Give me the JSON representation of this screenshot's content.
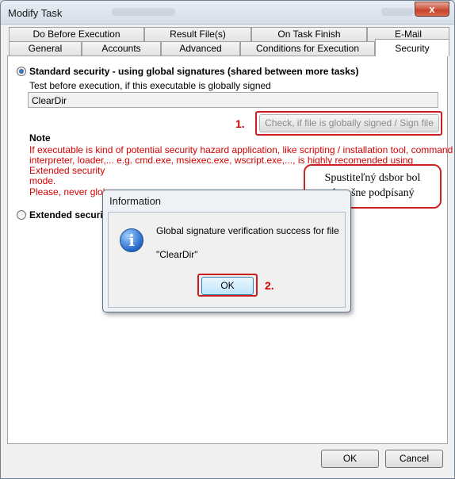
{
  "window": {
    "title": "Modify Task",
    "close_glyph": "x"
  },
  "tabs_top": [
    "Do Before Execution",
    "Result File(s)",
    "On Task Finish",
    "E-Mail"
  ],
  "tabs_bottom": [
    "General",
    "Accounts",
    "Advanced",
    "Conditions for Execution",
    "Security"
  ],
  "security": {
    "standard_label": "Standard security - using global signatures (shared between more tasks)",
    "test_label": "Test before execution, if this executable is globally signed",
    "executable_value": "ClearDir",
    "check_button": "Check, if file is globally signed / Sign file",
    "note_heading": "Note",
    "note_text_1": "If executable is kind of potential security hazard application, like scripting / installation tool, command",
    "note_text_2": "interpreter, loader,... e.g. cmd.exe, msiexec.exe, wscript.exe,..., is highly recomended using Extended security",
    "note_text_3": "mode.",
    "warning_text": "Please, never globa",
    "extended_label": "Extended securi"
  },
  "dialog": {
    "title": "Information",
    "message_line1": "Global signature verification success for file",
    "message_line2": "\"ClearDir\"",
    "ok_label": "OK",
    "icon": "info-icon"
  },
  "annotations": {
    "step1": "1.",
    "step2": "2.",
    "callout_line1": "Spustiteľný dsbor bol",
    "callout_line2": "úspešne podpísaný"
  },
  "footer": {
    "ok_label": "OK",
    "cancel_label": "Cancel"
  },
  "colors": {
    "accent_red": "#d40000",
    "annotation_red": "#cc1c1c"
  }
}
